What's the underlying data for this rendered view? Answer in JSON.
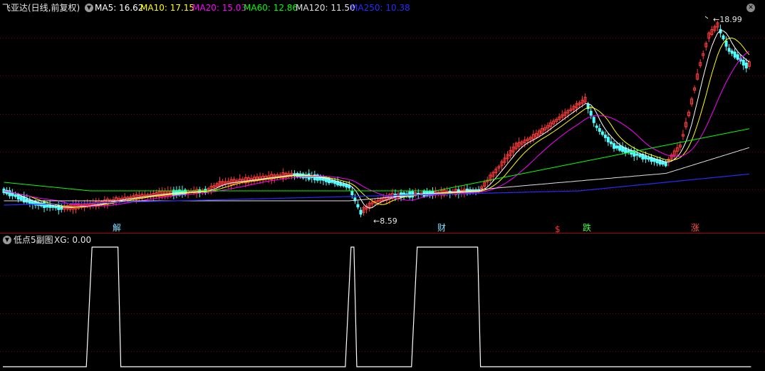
{
  "header": {
    "title": "飞亚达(日线,前复权)",
    "ma": [
      {
        "label": "MA5: 16.62",
        "color": "#ffffff"
      },
      {
        "label": "MA10: 17.15",
        "color": "#ffff00"
      },
      {
        "label": "MA20: 15.03",
        "color": "#ff00ff"
      },
      {
        "label": "MA60: 12.86",
        "color": "#00ff00"
      },
      {
        "label": "MA120: 11.50",
        "color": "#e0e0e0"
      },
      {
        "label": "MA250: 10.38",
        "color": "#2a2aff"
      }
    ]
  },
  "price_chart": {
    "high_label": "18.99",
    "low_label": "8.59",
    "signals": [
      {
        "text": "解",
        "color": "#7fe0ff"
      },
      {
        "text": "财",
        "color": "#7fe0ff"
      },
      {
        "text": "$",
        "color": "#ff3333"
      },
      {
        "text": "跌",
        "color": "#40ff40"
      },
      {
        "text": "涨",
        "color": "#ff5050"
      }
    ]
  },
  "indicator": {
    "name": "低点5副图",
    "xg_label": "XG: 0.00",
    "xg_series": [
      {
        "from": 0,
        "to": 29,
        "value": 0
      },
      {
        "from": 30,
        "to": 40,
        "value": 1
      },
      {
        "from": 41,
        "to": 119,
        "value": 0
      },
      {
        "from": 120,
        "to": 122,
        "value": 1
      },
      {
        "from": 123,
        "to": 142,
        "value": 0
      },
      {
        "from": 143,
        "to": 165,
        "value": 1
      },
      {
        "from": 166,
        "to": 260,
        "value": 0
      }
    ]
  },
  "colors": {
    "up": "#ff3b3b",
    "down": "#54ffff",
    "grid": "#7a0000",
    "xg_line": "#ffffff"
  }
}
